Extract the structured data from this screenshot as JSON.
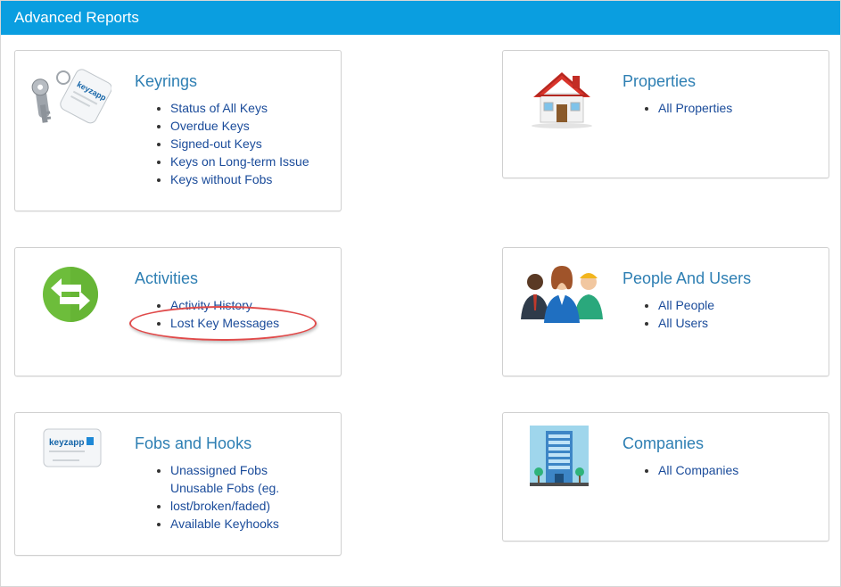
{
  "header": {
    "title": "Advanced Reports"
  },
  "colors": {
    "header": "#0a9ee0",
    "title": "#2e7fb3",
    "link": "#1a4b9a",
    "annotation": "#e04a4a"
  },
  "cards": {
    "keyrings": {
      "icon": "keyring-icon",
      "title": "Keyrings",
      "links": [
        "Status of All Keys",
        "Overdue Keys",
        "Signed-out Keys",
        "Keys on Long-term Issue",
        "Keys without Fobs"
      ]
    },
    "properties": {
      "icon": "house-icon",
      "title": "Properties",
      "links": [
        "All Properties"
      ]
    },
    "activities": {
      "icon": "exchange-arrows-icon",
      "title": "Activities",
      "links": [
        "Activity History",
        "Lost Key Messages"
      ]
    },
    "people": {
      "icon": "people-group-icon",
      "title": "People And Users",
      "links": [
        "All People",
        "All Users"
      ]
    },
    "fobs": {
      "icon": "fob-card-icon",
      "title": "Fobs and Hooks",
      "links": [
        "Unassigned Fobs",
        "Unusable Fobs (eg. lost/broken/faded)",
        "Available Keyhooks"
      ]
    },
    "companies": {
      "icon": "office-building-icon",
      "title": "Companies",
      "links": [
        "All Companies"
      ]
    }
  },
  "logos": {
    "keyzapp_tag": "keyzapp",
    "keyzapp_fob": "keyzapp"
  }
}
